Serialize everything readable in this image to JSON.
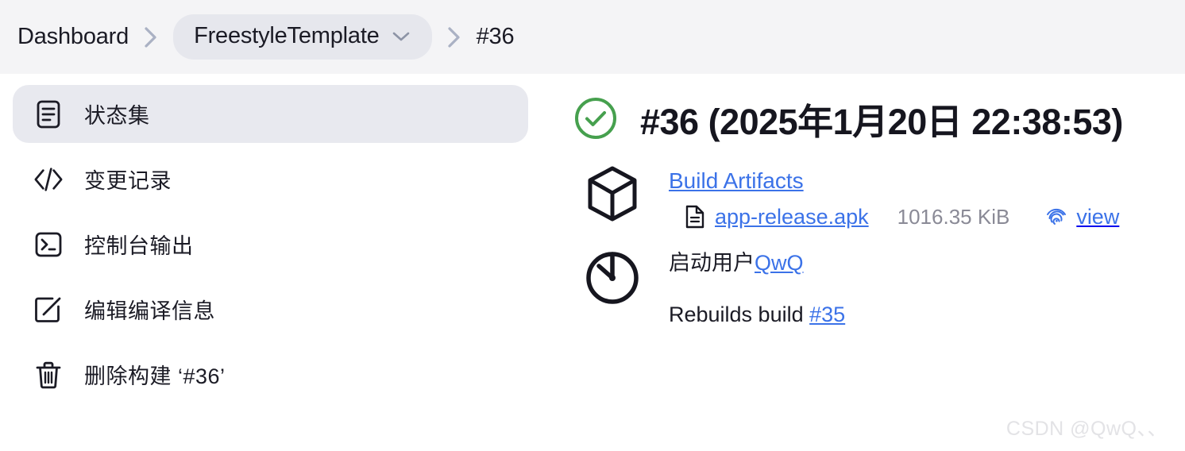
{
  "breadcrumb": {
    "root_label": "Dashboard",
    "project_label": "FreestyleTemplate",
    "build_label": "#36",
    "separator_icon": "chevron-right-icon",
    "dropdown_icon": "chevron-down-icon"
  },
  "sidebar": {
    "items": [
      {
        "label": "状态集",
        "icon": "document-lines-icon",
        "active": true
      },
      {
        "label": "变更记录",
        "icon": "code-brackets-icon",
        "active": false
      },
      {
        "label": "控制台输出",
        "icon": "terminal-icon",
        "active": false
      },
      {
        "label": "编辑编译信息",
        "icon": "edit-square-pencil-icon",
        "active": false
      },
      {
        "label": "删除构建 ‘#36’",
        "icon": "trash-icon",
        "active": false
      }
    ]
  },
  "main": {
    "status_icon": "check-circle-icon",
    "status_color": "#46a04e",
    "build_title": "#36 (2025年1月20日 22:38:53)",
    "artifacts": {
      "icon": "cube-box-icon",
      "heading": "Build Artifacts",
      "file_icon": "file-document-icon",
      "file_name": "app-release.apk",
      "file_size": "1016.35 KiB",
      "view_icon": "fingerprint-icon",
      "view_label": "view"
    },
    "trigger": {
      "icon": "clock-timer-icon",
      "started_by_label": "启动用户",
      "started_by_user": "QwQ",
      "rebuild_label": "Rebuilds build",
      "rebuild_ref": "#35"
    }
  },
  "watermark": "CSDN @QwQ、、",
  "colors": {
    "link_blue": "#3b72e8",
    "success_green": "#46a04e",
    "bar_bg": "#f4f4f6",
    "pill_bg": "#e6e7ed",
    "active_item_bg": "#e8e9ef",
    "muted_text": "#8a8a96"
  }
}
